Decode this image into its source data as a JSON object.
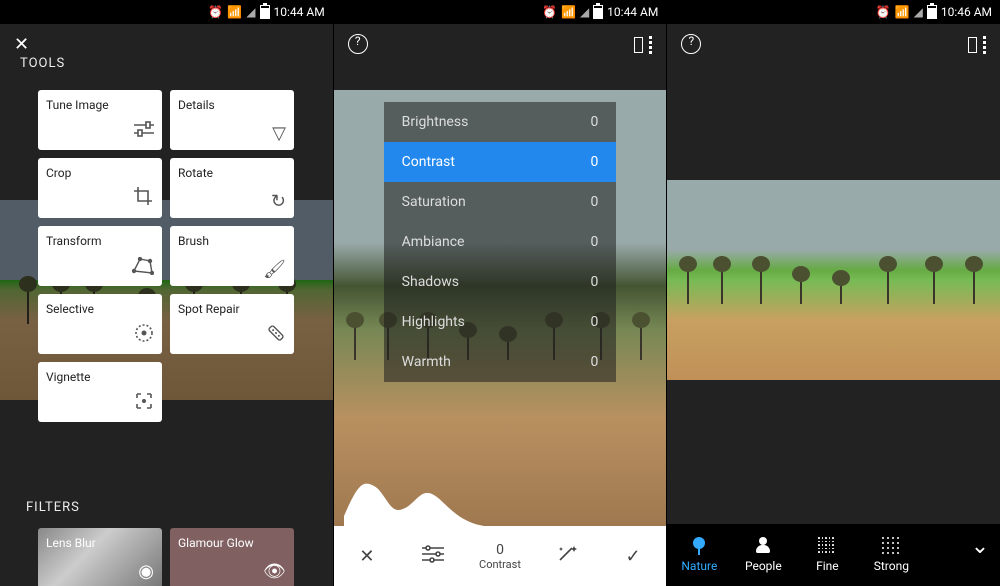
{
  "status": {
    "time_a": "10:44 AM",
    "time_b": "10:44 AM",
    "time_c": "10:46 AM"
  },
  "panel1": {
    "header_tools": "TOOLS",
    "header_filters": "FILTERS",
    "tools": [
      {
        "label": "Tune Image"
      },
      {
        "label": "Details"
      },
      {
        "label": "Crop"
      },
      {
        "label": "Rotate"
      },
      {
        "label": "Transform"
      },
      {
        "label": "Brush"
      },
      {
        "label": "Selective"
      },
      {
        "label": "Spot Repair"
      },
      {
        "label": "Vignette"
      }
    ],
    "filters": [
      {
        "label": "Lens Blur"
      },
      {
        "label": "Glamour Glow"
      }
    ]
  },
  "panel2": {
    "params": [
      {
        "name": "Brightness",
        "value": "0",
        "selected": false
      },
      {
        "name": "Contrast",
        "value": "0",
        "selected": true
      },
      {
        "name": "Saturation",
        "value": "0",
        "selected": false
      },
      {
        "name": "Ambiance",
        "value": "0",
        "selected": false
      },
      {
        "name": "Shadows",
        "value": "0",
        "selected": false
      },
      {
        "name": "Highlights",
        "value": "0",
        "selected": false
      },
      {
        "name": "Warmth",
        "value": "0",
        "selected": false
      }
    ],
    "current_name": "Contrast",
    "current_value": "0"
  },
  "panel3": {
    "tabs": [
      {
        "label": "Nature",
        "selected": true
      },
      {
        "label": "People",
        "selected": false
      },
      {
        "label": "Fine",
        "selected": false
      },
      {
        "label": "Strong",
        "selected": false
      }
    ]
  }
}
